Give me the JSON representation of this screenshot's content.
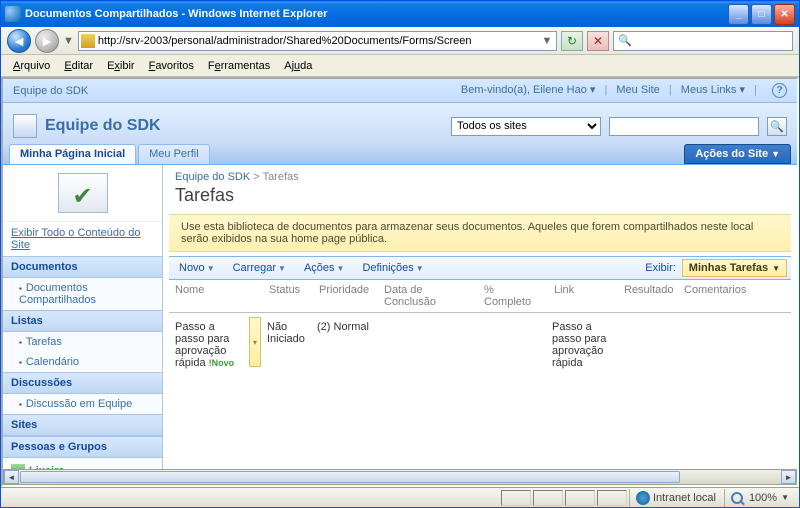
{
  "window": {
    "title": "Documentos Compartilhados - Windows Internet Explorer"
  },
  "address": {
    "url": "http://srv-2003/personal/administrador/Shared%20Documents/Forms/Screen"
  },
  "menubar": [
    "Arquivo",
    "Editar",
    "Exibir",
    "Favoritos",
    "Ferramentas",
    "Ajuda"
  ],
  "globalbar": {
    "breadcrumb": "Equipe do SDK",
    "welcome": "Bem-vindo(a), Eilene Hao",
    "mysite": "Meu Site",
    "mylinks": "Meus Links"
  },
  "site": {
    "title": "Equipe do SDK",
    "scope": "Todos os sites"
  },
  "tabs": {
    "home": "Minha Página Inicial",
    "profile": "Meu Perfil",
    "actions": "Ações do Site"
  },
  "ql": {
    "viewall": "Exibir Todo o Conteúdo do Site",
    "docs_h": "Documentos",
    "docs_1": "Documentos Compartilhados",
    "lists_h": "Listas",
    "lists_1": "Tarefas",
    "lists_2": "Calendário",
    "disc_h": "Discussões",
    "disc_1": "Discussão em Equipe",
    "sites_h": "Sites",
    "people_h": "Pessoas e Grupos",
    "recycle": "Lixeira"
  },
  "main": {
    "bc_site": "Equipe do SDK",
    "bc_list": "Tarefas",
    "title": "Tarefas",
    "desc": "Use esta biblioteca de documentos para armazenar seus documentos. Aqueles que forem compartilhados neste local serão exibidos na sua home page pública."
  },
  "toolbar": {
    "novo": "Novo",
    "carregar": "Carregar",
    "acoes": "Ações",
    "defs": "Definições",
    "exibir": "Exibir:",
    "view": "Minhas Tarefas"
  },
  "cols": {
    "nome": "Nome",
    "status": "Status",
    "prio": "Prioridade",
    "data": "Data de Conclusão",
    "pct": "% Completo",
    "link": "Link",
    "res": "Resultado",
    "com": "Comentarios"
  },
  "row": {
    "nome": "Passo a passo para aprovação rápida",
    "novo": "!Novo",
    "status": "Não Iniciado",
    "prio": "(2) Normal",
    "link": "Passo a passo para aprovação rápida"
  },
  "statusbar": {
    "zone": "Intranet local",
    "zoom": "100%"
  }
}
